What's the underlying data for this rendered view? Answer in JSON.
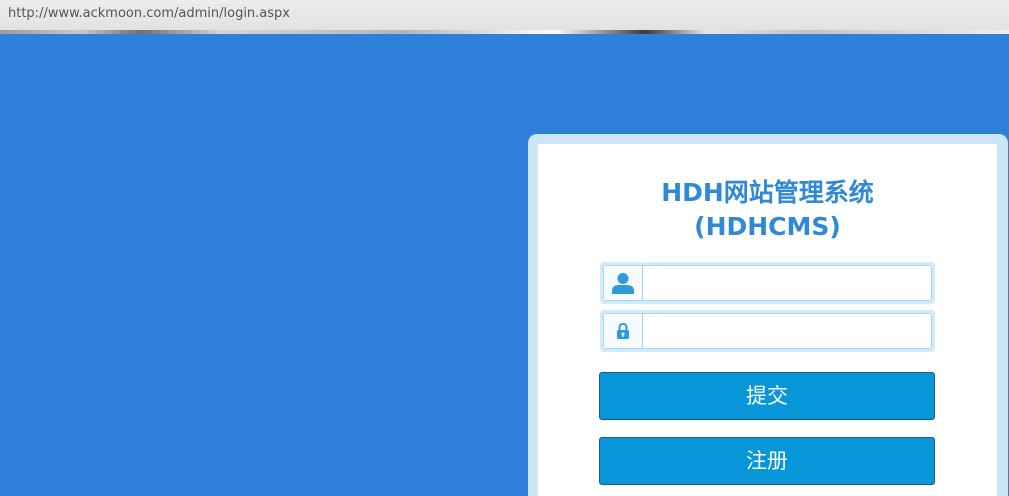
{
  "browser": {
    "url": "http://www.ackmoon.com/admin/login.aspx"
  },
  "login": {
    "title_line1": "HDH网站管理系统",
    "title_line2": "(HDHCMS)",
    "username": {
      "value": "",
      "placeholder": ""
    },
    "password": {
      "value": "",
      "placeholder": ""
    },
    "submit_label": "提交",
    "register_label": "注册"
  },
  "colors": {
    "background": "#2f80da",
    "title": "#2f89d6",
    "button": "#0797d9",
    "card_border": "#cde6f7"
  },
  "icons": {
    "username_icon": "user-icon",
    "password_icon": "lock-icon"
  }
}
